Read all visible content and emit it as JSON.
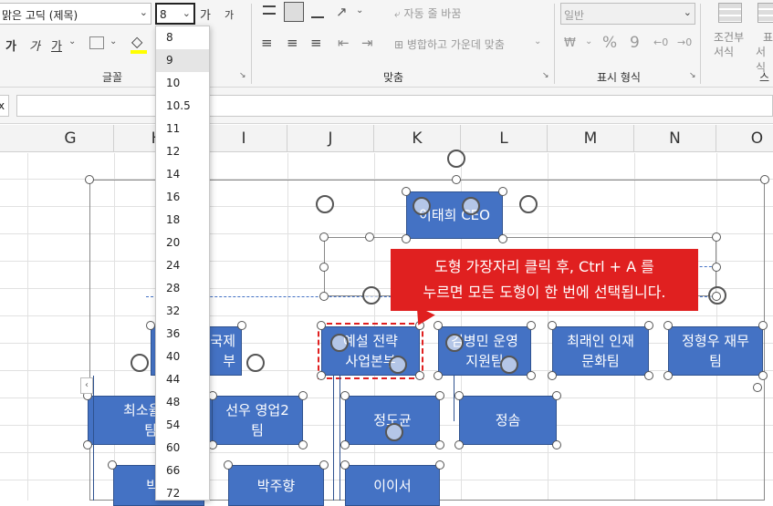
{
  "ribbon": {
    "font_name": "맑은 고딕 (제목)",
    "font_size": "8",
    "grow_font": "가",
    "shrink_font": "가",
    "bold": "가",
    "italic": "가",
    "underline": "가",
    "group_font": "글꼴",
    "group_align": "맞춤",
    "group_number": "표시 형식",
    "wrap_text": "자동 줄 바꿈",
    "merge_center": "병합하고 가운데 맞춤",
    "number_format": "일반",
    "percent": "%",
    "comma": "9",
    "cond_format_line1": "조건부",
    "cond_format_line2": "서식",
    "table_format_line1": "표",
    "table_format_line2": "서식",
    "style_group_partial": "스"
  },
  "formula_bar": {
    "name_box_partial": "x"
  },
  "columns": [
    "G",
    "H",
    "I",
    "J",
    "K",
    "L",
    "M",
    "N",
    "O"
  ],
  "font_size_options": [
    "8",
    "9",
    "10",
    "10.5",
    "11",
    "12",
    "14",
    "16",
    "18",
    "20",
    "24",
    "28",
    "32",
    "36",
    "40",
    "44",
    "48",
    "54",
    "60",
    "66",
    "72"
  ],
  "font_size_hover": "9",
  "shapes": {
    "ceo": "이태희 CEO",
    "strategy_line1": "예설 전략",
    "strategy_line2": "사업본부",
    "ops_line1": "김병민 운영",
    "ops_line2": "지원팀",
    "hr_line1": "최래인 인재",
    "hr_line2": "문화팀",
    "finance_line1": "정형우 재무",
    "finance_line2": "팀",
    "partial_left_line1": "국제",
    "partial_left_line2": "부",
    "sales1_line1": "최소율 영",
    "sales1_line2": "팀",
    "sales2_line1": "선우 영업2",
    "sales2_line2": "팀",
    "jeongdogyu": "정도균",
    "jeongsom": "정솜",
    "bottom_left_partial": "박민",
    "bakjuhyang": "박주향",
    "leeiseo": "이이서"
  },
  "callout": {
    "line1": "도형 가장자리 클릭 후, Ctrl + A 를",
    "line2": "누르면 모든 도형이 한 번에 선택됩니다."
  },
  "colors": {
    "shape_fill": "#4472c4",
    "callout_fill": "#e02020",
    "selection_dash": "#e02020"
  }
}
